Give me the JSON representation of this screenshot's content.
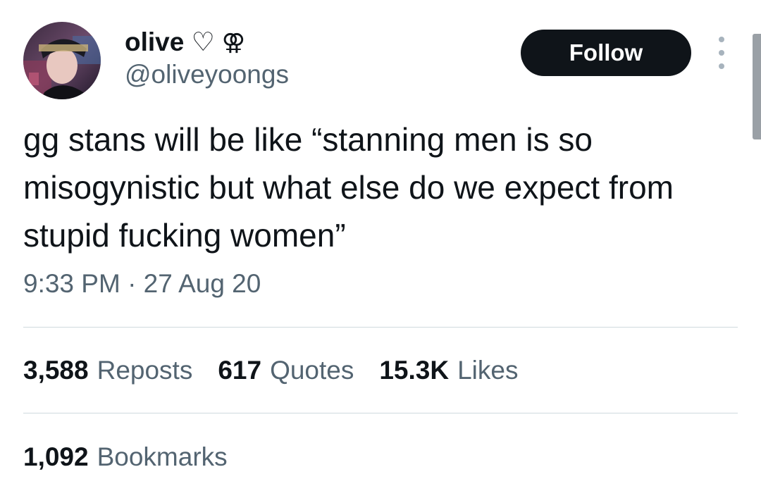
{
  "user": {
    "display_name": "olive ♡",
    "name_badge": "⚢",
    "handle": "@oliveyoongs"
  },
  "header": {
    "follow_label": "Follow",
    "more_icon": "vertical-ellipsis-icon"
  },
  "tweet": {
    "text": "gg stans will be like “stanning men is so misogynistic but what else do we expect from stupid fucking women”",
    "timestamp": "9:33 PM · 27 Aug 20"
  },
  "stats": {
    "reposts_count": "3,588",
    "reposts_label": "Reposts",
    "quotes_count": "617",
    "quotes_label": "Quotes",
    "likes_count": "15.3K",
    "likes_label": "Likes",
    "bookmarks_count": "1,092",
    "bookmarks_label": "Bookmarks"
  },
  "colors": {
    "text_primary": "#0f1419",
    "text_secondary": "#536471",
    "button_bg": "#0f1419",
    "divider": "#cfd9de"
  }
}
